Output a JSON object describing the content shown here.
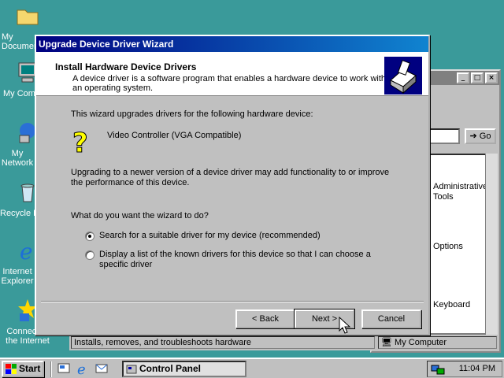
{
  "desktop": {
    "icons": [
      {
        "label": "My Documents"
      },
      {
        "label": "My Computer"
      },
      {
        "label": "My Network Places"
      },
      {
        "label": "Recycle Bin"
      },
      {
        "label": "Internet Explorer"
      },
      {
        "label": "Connect to the Internet"
      }
    ]
  },
  "control_panel": {
    "go_label": "Go",
    "items": [
      {
        "label": "Administrative Tools"
      },
      {
        "label": "Options"
      },
      {
        "label": "Keyboard"
      }
    ],
    "status_left": "Installs, removes, and troubleshoots hardware",
    "status_right": "My Computer"
  },
  "wizard": {
    "title": "Upgrade Device Driver Wizard",
    "header_title": "Install Hardware Device Drivers",
    "header_desc": "A device driver is a software program that enables a hardware device to work with an operating system.",
    "intro": "This wizard upgrades drivers for the following hardware device:",
    "device_name": "Video Controller (VGA Compatible)",
    "upgrade_text": "Upgrading to a newer version of a device driver may add functionality to or improve the performance of this device.",
    "question": "What do you want the wizard to do?",
    "options": [
      {
        "label": "Search for a suitable driver for my device (recommended)",
        "selected": true
      },
      {
        "label": "Display a list of the known drivers for this device so that I can choose a specific driver",
        "selected": false
      }
    ],
    "back_label": "< Back",
    "next_label": "Next >",
    "cancel_label": "Cancel"
  },
  "taskbar": {
    "start_label": "Start",
    "task_label": "Control Panel",
    "clock": "11:04 PM"
  },
  "colors": {
    "desktop": "#3a9a9a",
    "title_bar": "#000080"
  }
}
